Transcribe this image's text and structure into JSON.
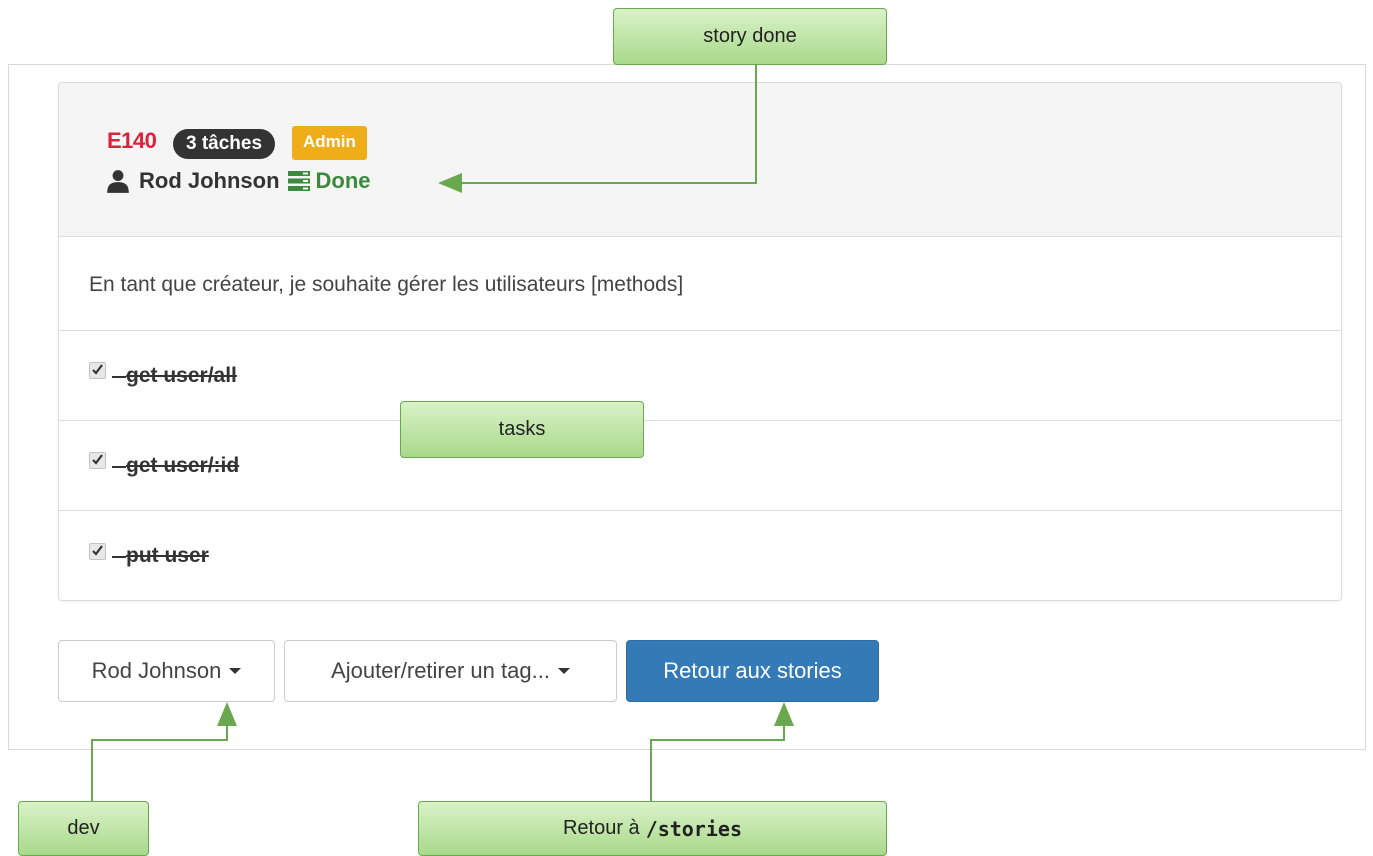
{
  "story": {
    "id": "E140",
    "tasks_badge": "3 tâches",
    "tag_badge": "Admin",
    "owner": "Rod Johnson",
    "status": "Done",
    "description": "En tant que créateur, je souhaite gérer les utilisateurs [methods]"
  },
  "tasks": [
    {
      "label": "get user/all",
      "checked": true
    },
    {
      "label": "get user/:id",
      "checked": true
    },
    {
      "label": "put user",
      "checked": true
    }
  ],
  "actions": {
    "dev_button": "Rod Johnson",
    "tag_button": "Ajouter/retirer un tag...",
    "back_button": "Retour aux stories"
  },
  "annotations": {
    "story_done": "story done",
    "tasks": "tasks",
    "dev": "dev",
    "retour_prefix": "Retour à",
    "retour_path": "/stories"
  },
  "colors": {
    "story_id": "#e0213c",
    "status_done": "#3c8a3c",
    "tag_admin": "#f0ad1a",
    "primary_button": "#337ab7",
    "callout_border": "#6aa84f"
  }
}
